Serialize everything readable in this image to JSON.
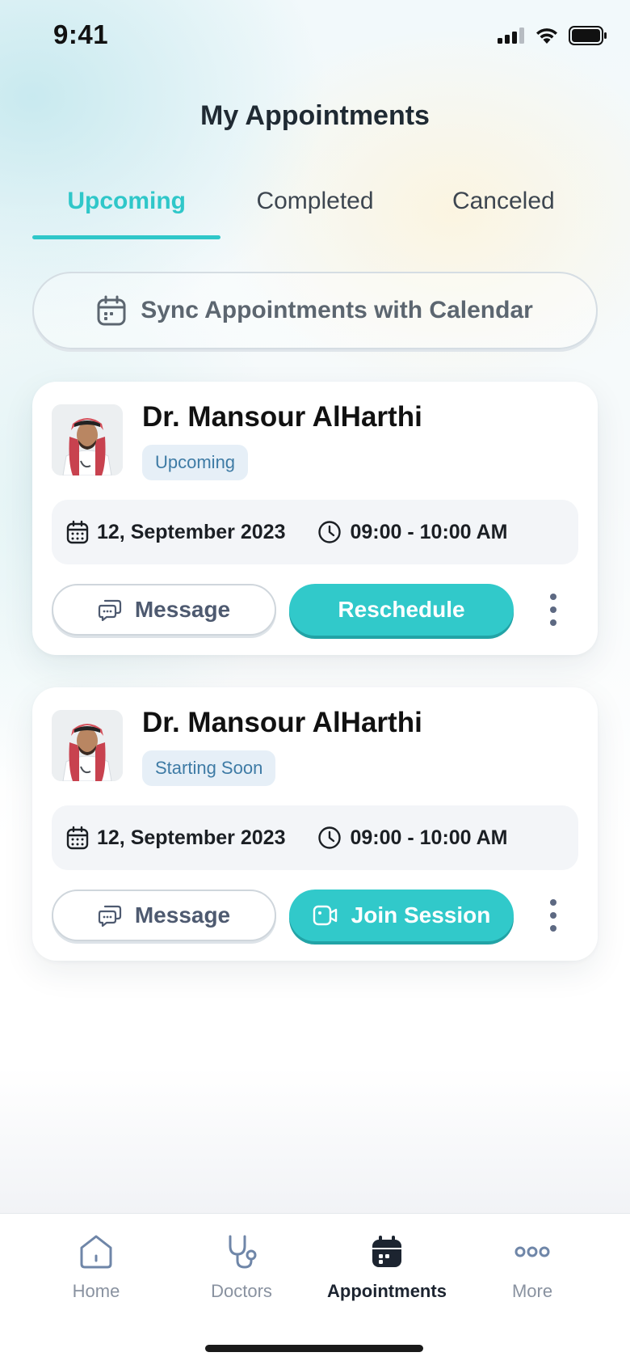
{
  "status_bar": {
    "time": "9:41"
  },
  "page": {
    "title": "My Appointments"
  },
  "tabs": [
    {
      "label": "Upcoming",
      "active": true
    },
    {
      "label": "Completed",
      "active": false
    },
    {
      "label": "Canceled",
      "active": false
    }
  ],
  "sync": {
    "label": "Sync Appointments with Calendar",
    "icon": "calendar-icon"
  },
  "appointments": [
    {
      "doctor": "Dr. Mansour AlHarthi",
      "status": "Upcoming",
      "date": "12, September 2023",
      "time": "09:00 - 10:00 AM",
      "secondary_action": "Message",
      "primary_action": "Reschedule",
      "primary_icon": null
    },
    {
      "doctor": "Dr. Mansour AlHarthi",
      "status": "Starting Soon",
      "date": "12, September 2023",
      "time": "09:00 - 10:00 AM",
      "secondary_action": "Message",
      "primary_action": "Join Session",
      "primary_icon": "video-icon"
    }
  ],
  "bottom_nav": [
    {
      "label": "Home",
      "icon": "home-icon",
      "active": false
    },
    {
      "label": "Doctors",
      "icon": "stethoscope-icon",
      "active": false
    },
    {
      "label": "Appointments",
      "icon": "calendar-icon",
      "active": true
    },
    {
      "label": "More",
      "icon": "more-icon",
      "active": false
    }
  ],
  "colors": {
    "accent": "#31c9ca",
    "badge_bg": "#e6eff7",
    "badge_text": "#3e7ba5",
    "text_dark": "#1c2430"
  }
}
